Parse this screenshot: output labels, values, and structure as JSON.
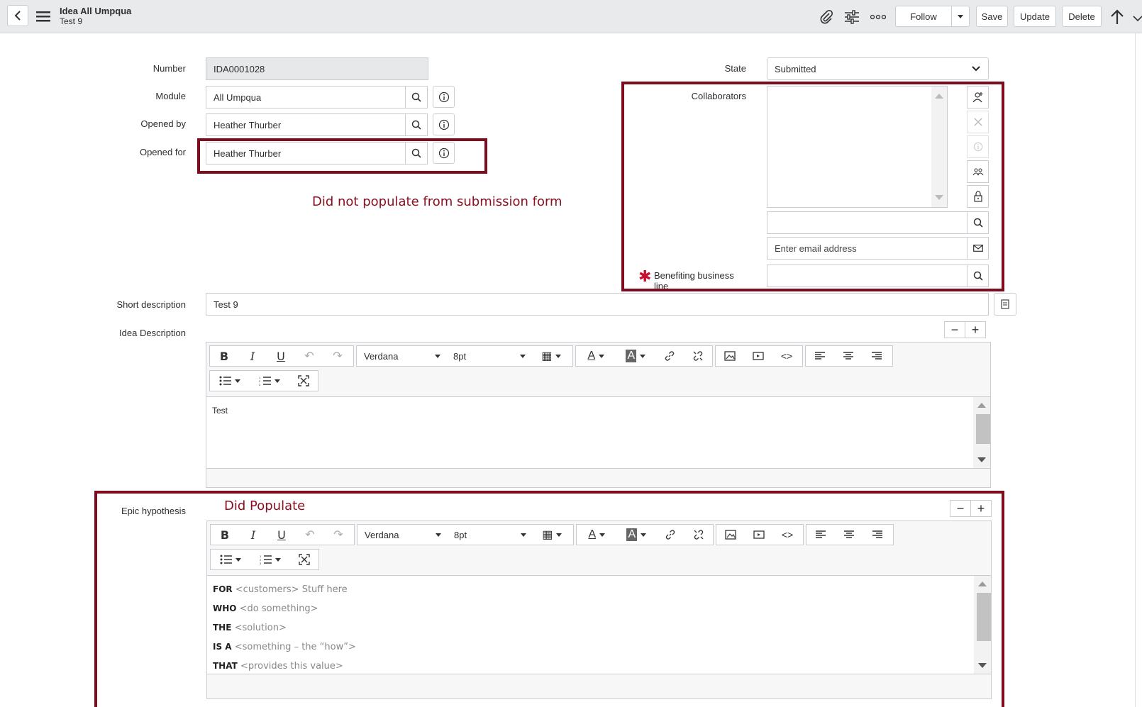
{
  "header": {
    "title": "Idea All Umpqua",
    "subtitle": "Test 9",
    "follow": "Follow",
    "save": "Save",
    "update": "Update",
    "delete": "Delete"
  },
  "form": {
    "number_label": "Number",
    "number_value": "IDA0001028",
    "module_label": "Module",
    "module_value": "All Umpqua",
    "opened_by_label": "Opened by",
    "opened_by_value": "Heather Thurber",
    "opened_for_label": "Opened for",
    "opened_for_value": "Heather Thurber",
    "state_label": "State",
    "state_value": "Submitted",
    "collaborators_label": "Collaborators",
    "email_placeholder": "Enter email address",
    "benefiting_label": "Benefiting business line",
    "short_desc_label": "Short description",
    "short_desc_value": "Test 9",
    "idea_desc_label": "Idea Description",
    "idea_desc_text": "Test",
    "epic_label": "Epic hypothesis"
  },
  "annotations": {
    "not_populate": "Did not populate from submission form",
    "did_populate": "Did Populate"
  },
  "editor": {
    "font": "Verdana",
    "size": "8pt"
  },
  "hypothesis": [
    {
      "kw": "FOR",
      "text": "<customers> Stuff here"
    },
    {
      "kw": "WHO",
      "text": "<do something>"
    },
    {
      "kw": "THE",
      "text": "<solution>"
    },
    {
      "kw": "IS A",
      "text": "<something – the “how”>"
    },
    {
      "kw": "THAT",
      "text": "<provides this value>"
    }
  ],
  "colors": {
    "annotation_red": "#7e0b1e",
    "header_bg": "#e8eaec",
    "required": "#c8102e"
  }
}
